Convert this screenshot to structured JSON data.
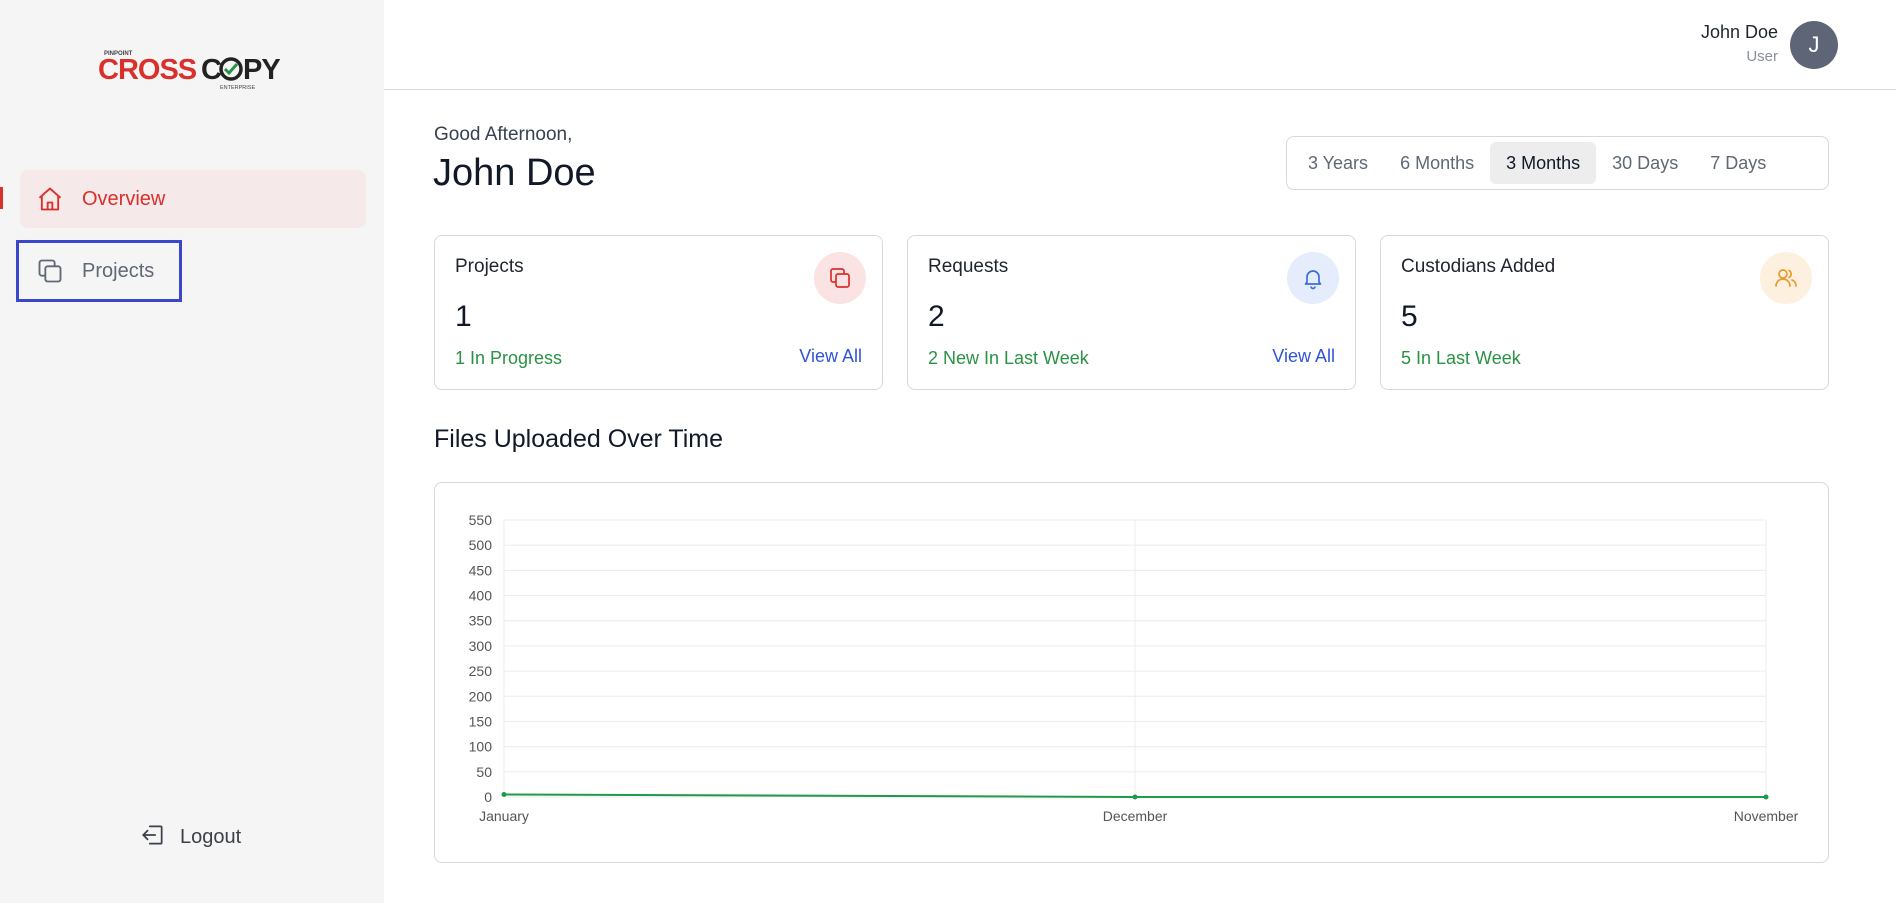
{
  "brand": {
    "logo_text": "CROSSCOPY",
    "logo_top": "PINPOINT",
    "logo_bottom": "ENTERPRISE"
  },
  "sidebar": {
    "items": [
      {
        "label": "Overview",
        "icon": "home-icon",
        "active": true
      },
      {
        "label": "Projects",
        "icon": "copy-icon",
        "active": false
      }
    ],
    "logout_label": "Logout"
  },
  "header": {
    "user_name": "John Doe",
    "user_role": "User",
    "avatar_initial": "J"
  },
  "main": {
    "greeting": "Good Afternoon,",
    "name": "John Doe",
    "ranges": [
      "3 Years",
      "6 Months",
      "3 Months",
      "30 Days",
      "7 Days"
    ],
    "active_range": "3 Months",
    "cards": [
      {
        "title": "Projects",
        "value": "1",
        "sub": "1 In Progress",
        "link": "View All",
        "icon": "copy-icon",
        "color": "#d9302c"
      },
      {
        "title": "Requests",
        "value": "2",
        "sub": "2 New In Last Week",
        "link": "View All",
        "icon": "bell-icon",
        "color": "#3b6fd8"
      },
      {
        "title": "Custodians Added",
        "value": "5",
        "sub": "5 In Last Week",
        "link": "",
        "icon": "users-icon",
        "color": "#e89a2c"
      }
    ],
    "chart_title": "Files Uploaded Over Time"
  },
  "colors": {
    "accent": "#d9302c",
    "success": "#2a9244",
    "link": "#3055d6",
    "line": "#1e9a4a"
  },
  "chart_data": {
    "type": "line",
    "categories": [
      "January",
      "December",
      "November"
    ],
    "series": [
      {
        "values": [
          5,
          0,
          0
        ]
      }
    ],
    "ylim": [
      0,
      550
    ],
    "yticks": [
      0,
      50,
      100,
      150,
      200,
      250,
      300,
      350,
      400,
      450,
      500,
      550
    ],
    "grid": true
  }
}
